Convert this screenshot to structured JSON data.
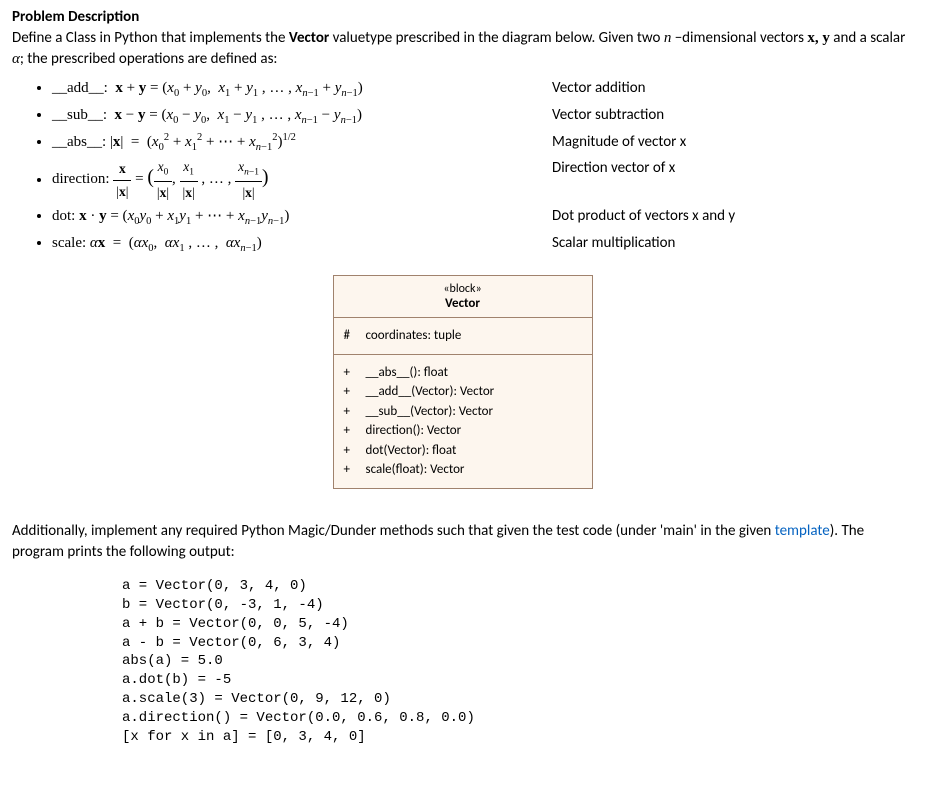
{
  "heading": "Problem Description",
  "intro_part1": "Define a Class in Python that implements the ",
  "intro_bold": "Vector",
  "intro_part2": " valuetype prescribed in the diagram below. Given two ",
  "intro_part3": " −dimensional vectors ",
  "intro_part4": " and a scalar ",
  "intro_part5": "; the prescribed operations are defined as:",
  "ops": {
    "add": {
      "def": "__add__:  𝐱 + 𝐲 = (x₀ + y₀,  x₁ + y₁ , … , xₙ₋₁ + yₙ₋₁)",
      "desc": "Vector addition"
    },
    "sub": {
      "def": "__sub__:  𝐱 − 𝐲 = (x₀ − y₀,  x₁ − y₁ , … , xₙ₋₁ − yₙ₋₁)",
      "desc": "Vector subtraction"
    },
    "abs": {
      "desc": "Magnitude of vector x"
    },
    "direction": {
      "desc": "Direction vector of x"
    },
    "dot": {
      "def": "dot: 𝐱 · 𝐲 = (x₀y₀ + x₁y₁ + ⋯ + xₙ₋₁yₙ₋₁)",
      "desc": "Dot product of vectors x and y"
    },
    "scale": {
      "def": "scale: α𝐱  =  (αx₀,  αx₁ , … ,  αxₙ₋₁)",
      "desc": "Scalar multiplication"
    }
  },
  "uml": {
    "stereotype": "«block»",
    "name": "Vector",
    "attr_vis": "#",
    "attr": "coordinates: tuple",
    "methods": [
      {
        "vis": "+",
        "sig": "__abs__(): float"
      },
      {
        "vis": "+",
        "sig": "__add__(Vector): Vector"
      },
      {
        "vis": "+",
        "sig": "__sub__(Vector): Vector"
      },
      {
        "vis": "+",
        "sig": "direction(): Vector"
      },
      {
        "vis": "+",
        "sig": "dot(Vector): float"
      },
      {
        "vis": "+",
        "sig": "scale(float): Vector"
      }
    ]
  },
  "para2_part1": "Additionally, implement any required Python Magic/Dunder methods such that given the test code (under 'main' in the given ",
  "para2_link": "template",
  "para2_part2": "). The program prints the following output:",
  "code": "a = Vector(0, 3, 4, 0)\nb = Vector(0, -3, 1, -4)\na + b = Vector(0, 0, 5, -4)\na - b = Vector(0, 6, 3, 4)\nabs(a) = 5.0\na.dot(b) = -5\na.scale(3) = Vector(0, 9, 12, 0)\na.direction() = Vector(0.0, 0.6, 0.8, 0.0)\n[x for x in a] = [0, 3, 4, 0]"
}
